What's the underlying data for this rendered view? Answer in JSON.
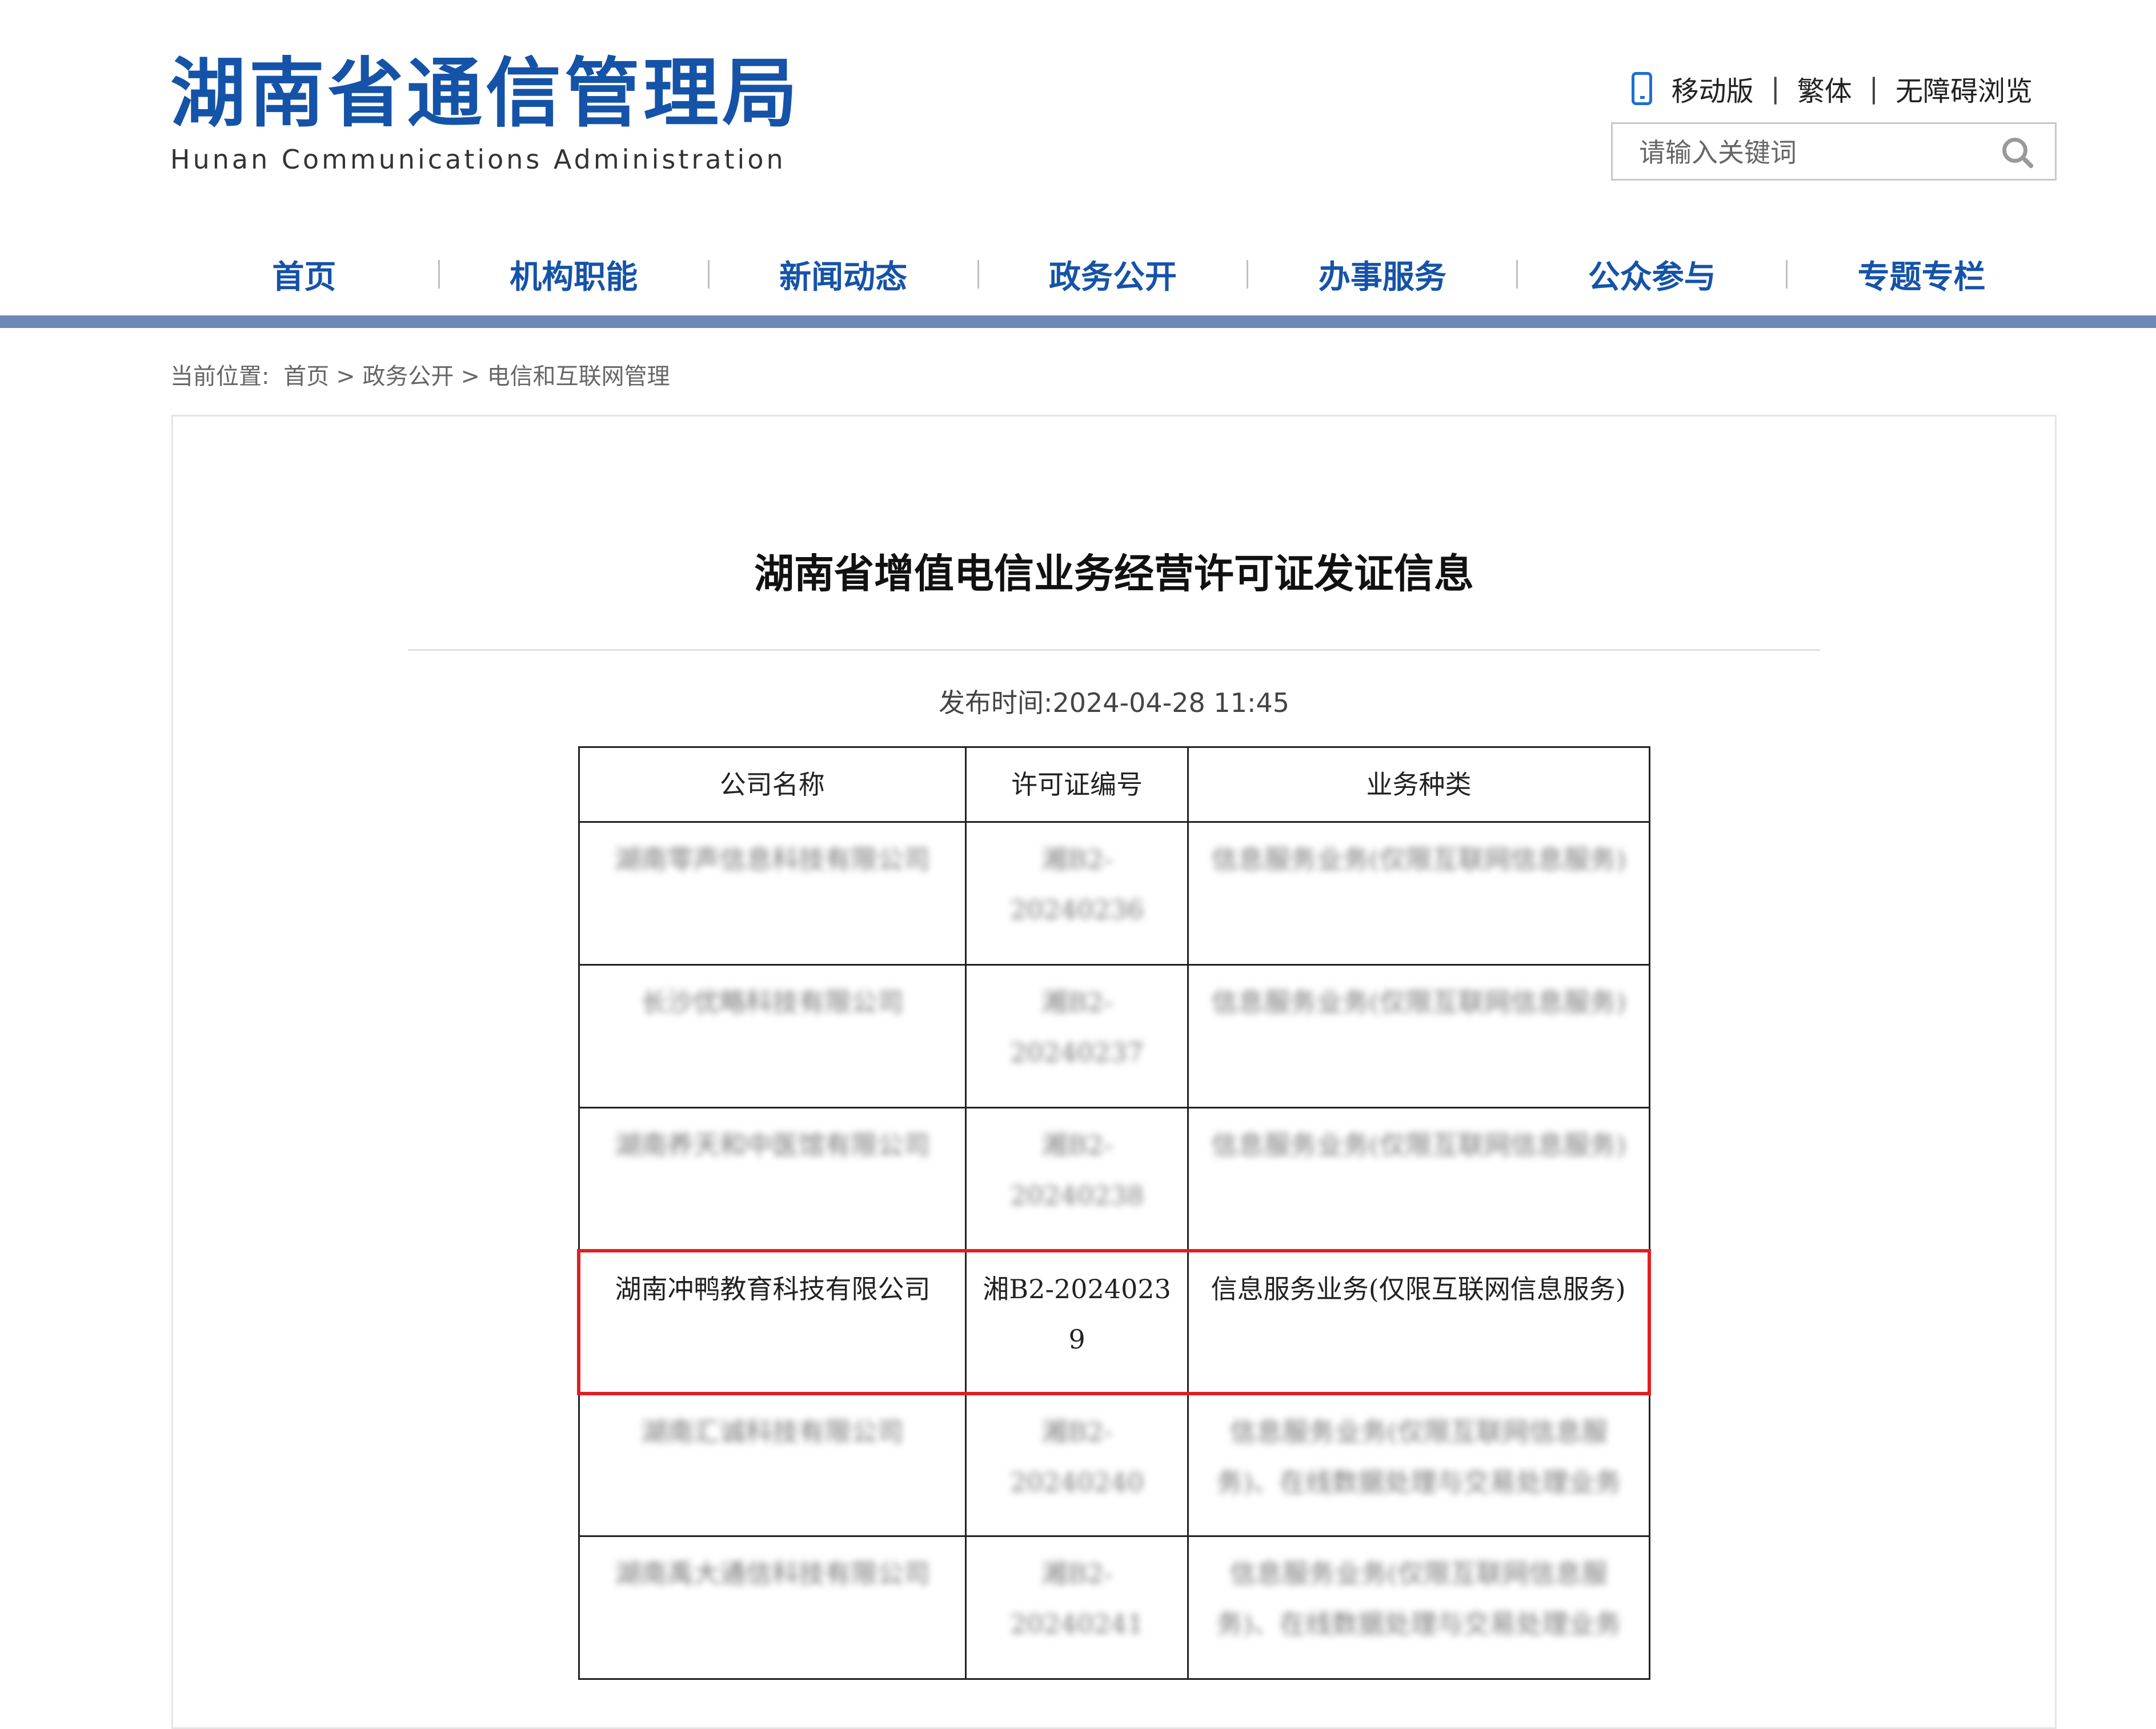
{
  "header": {
    "logo_cn": "湖南省通信管理局",
    "logo_en": "Hunan Communications Administration",
    "links": [
      "移动版",
      "繁体",
      "无障碍浏览"
    ],
    "search_placeholder": "请输入关键词"
  },
  "nav": [
    "首页",
    "机构职能",
    "新闻动态",
    "政务公开",
    "办事服务",
    "公众参与",
    "专题专栏"
  ],
  "breadcrumb": {
    "label": "当前位置:",
    "items": [
      "首页",
      "政务公开",
      "电信和互联网管理"
    ]
  },
  "article": {
    "title": "湖南省增值电信业务经营许可证发证信息",
    "publish_time": "发布时间:2024-04-28 11:45"
  },
  "table": {
    "headers": [
      "公司名称",
      "许可证编号",
      "业务种类"
    ],
    "rows": [
      {
        "company": "湖南零声信息科技有限公司",
        "license": "湘B2-20240236",
        "service": "信息服务业务(仅限互联网信息服务)",
        "blurred": true
      },
      {
        "company": "长沙优略科技有限公司",
        "license": "湘B2-20240237",
        "service": "信息服务业务(仅限互联网信息服务)",
        "blurred": true
      },
      {
        "company": "湖南养天和中医馆有限公司",
        "license": "湘B2-20240238",
        "service": "信息服务业务(仅限互联网信息服务)",
        "blurred": true
      },
      {
        "company": "湖南冲鸭教育科技有限公司",
        "license": "湘B2-2024023 9",
        "service": "信息服务业务(仅限互联网信息服务)",
        "blurred": false,
        "highlighted": true
      },
      {
        "company": "湖南汇诚科技有限公司",
        "license": "湘B2-20240240",
        "service": "信息服务业务(仅限互联网信息服务)、在线数据处理与交易处理业务",
        "blurred": true
      },
      {
        "company": "湖南禹大通信科技有限公司",
        "license": "湘B2-20240241",
        "service": "信息服务业务(仅限互联网信息服务)、在线数据处理与交易处理业务",
        "blurred": true
      }
    ]
  },
  "colors": {
    "brand": "#1553a8",
    "nav_bar": "#6d87b8",
    "highlight": "#e02020"
  }
}
